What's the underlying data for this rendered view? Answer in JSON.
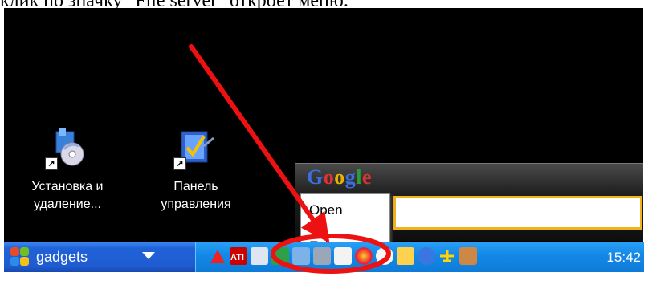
{
  "caption": "клик по значку \"File server\" откроет меню.",
  "desktop": {
    "icons": [
      {
        "label_line1": "Установка и",
        "label_line2": "удаление..."
      },
      {
        "label_line1": "Панель",
        "label_line2": "управления"
      }
    ],
    "shortcut_glyph": "↗"
  },
  "google_bar": {
    "logo": {
      "g": "G",
      "o1": "o",
      "o2": "o",
      "g2": "g",
      "l": "l",
      "e": "e"
    },
    "search_value": ""
  },
  "context_menu": {
    "items": [
      {
        "label": "Open"
      },
      {
        "label": "Exit"
      }
    ]
  },
  "taskbar": {
    "start_label": "gadgets",
    "clock": "15:42",
    "tray_icons": [
      "acrobat-icon",
      "ati-icon",
      "network-icon",
      "display-icon",
      "feather-icon",
      "pen-icon",
      "media-icon",
      "swirl-icon",
      "dog-icon",
      "notes-icon",
      "help-icon",
      "plane-icon",
      "user-icon"
    ]
  },
  "colors": {
    "annotation_red": "#ee1111",
    "taskbar_blue": "#1f5bd0",
    "tray_blue": "#1489e8",
    "google_border": "#f2b21a"
  }
}
